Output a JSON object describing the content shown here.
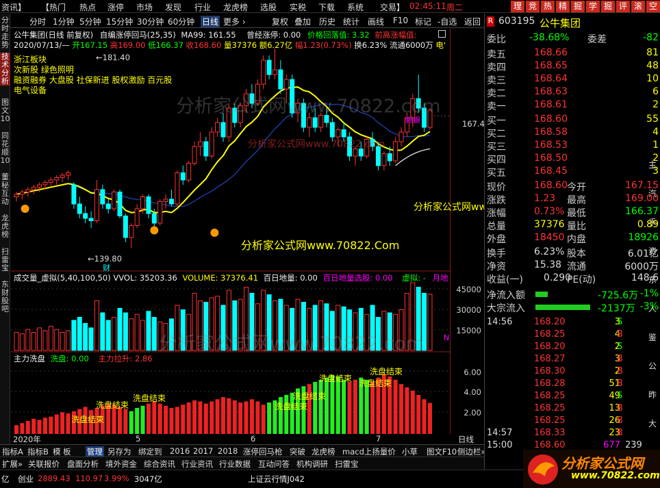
{
  "menubar": {
    "items": [
      "资讯】",
      "【热门",
      "热点",
      "涨停",
      "市场",
      "发现",
      "行业",
      "龙虎榜",
      "选股",
      "实税",
      "下载",
      "系统",
      "交易】"
    ],
    "clock": "02:45:11",
    "weekday": "周二",
    "badges": [
      "理",
      "竞",
      "热",
      "精",
      "掘",
      "学",
      "掘",
      "评",
      "滚",
      "空"
    ]
  },
  "toolbar": {
    "items": [
      "分时",
      "1分钟",
      "5分钟",
      "15分钟",
      "30分钟",
      "60分钟",
      "日线",
      "更多 ›",
      "复权",
      "叠加",
      "历史",
      "统计",
      "画线",
      "F10",
      "标记",
      "-自选",
      "返回"
    ],
    "active": "日线"
  },
  "leftnav": [
    "分时走势",
    "技术分析",
    "图文10",
    "同花顺10",
    "董秘互动",
    "龙虎榜",
    "扫雷宝",
    "东财股吧"
  ],
  "chart": {
    "title": "公牛集团(日线 前复权)",
    "indicator": "自编涨停回马(25,35)",
    "ma": "MA99: 161.55",
    "surge": "曾经涨停: 0.00",
    "pullback": "价格回落值: 3.32",
    "prevhigh": "前高涨幅值:",
    "date": "2020/07/13/—",
    "open": "开167.15",
    "high": "高169.00",
    "low": "低166.37",
    "close": "收168.60",
    "volume": "量37376",
    "amount": "额6.27亿",
    "chg": "幅1.23(0.73%)",
    "turnover": "换6.23%",
    "float": "流通6000万",
    "tail": "电'",
    "concepts": [
      "浙江板块",
      "次新股 绿色照明",
      "融资融券 大盘股 社保新进 股权激励 百元股",
      "电气设备"
    ],
    "hi_label": "181.40",
    "lo_label": "139.80",
    "cai": "财",
    "price_level": "167.4",
    "hammer": "蜥蜴",
    "vol_title": "成交量_虚拟(5,40,100,50)",
    "vol_wvol": "VVOL: 35203.36",
    "vol_volume": "VOLUME: 37376.41",
    "vol_bdl": "百日地量: 0.00",
    "vol_bdlxg": "百日地量选股: 0.00",
    "vol_xn": "虚拟: -",
    "vol_yd": "月地",
    "vol_axis": [
      "45000",
      "30000",
      "15000"
    ],
    "vol_n": "N",
    "zl_title": "主力洗盘",
    "zl_xp": "洗盘: 0.00",
    "zl_lx": "主力拉升: 2.86",
    "zl_axis": [
      "6.00",
      "4.00",
      "2.00"
    ],
    "zl_labels": [
      "洗盘结束",
      "洗盘结束",
      "洗盘结束",
      "洗盘结束",
      "洗盘结束",
      "洗盘结束",
      "洗盘结束",
      "洗盘结束",
      "洗盘结束"
    ],
    "x_labels": [
      "2020年",
      "5",
      "6",
      "7",
      "日线"
    ]
  },
  "chart_data": {
    "type": "candlestick",
    "candles": [
      [
        150.5,
        151.5,
        149.5,
        151
      ],
      [
        151,
        152,
        150,
        151.5
      ],
      [
        151.5,
        152.5,
        150.5,
        152
      ],
      [
        152,
        153,
        151,
        152.5
      ],
      [
        152.5,
        153.5,
        151.5,
        153
      ],
      [
        153,
        154,
        152,
        153.5
      ],
      [
        153.5,
        154.5,
        152.5,
        154
      ],
      [
        154,
        155,
        153,
        154.5
      ],
      [
        154.5,
        155.5,
        153.5,
        155
      ],
      [
        155,
        156,
        154,
        155.5
      ],
      [
        153,
        153.5,
        148,
        149
      ],
      [
        149,
        150.5,
        146,
        147
      ],
      [
        147,
        148.5,
        145,
        146
      ],
      [
        146,
        147.5,
        144,
        145.5
      ],
      [
        145.5,
        154,
        145,
        152
      ],
      [
        152,
        153,
        148,
        149
      ],
      [
        149,
        150,
        147,
        148
      ],
      [
        148,
        152,
        147.5,
        151.5
      ],
      [
        151.5,
        152,
        146,
        146.5
      ],
      [
        146.5,
        147,
        141,
        142
      ],
      [
        142,
        145,
        139.8,
        144.5
      ],
      [
        144.5,
        149,
        144,
        148
      ],
      [
        148,
        151,
        147,
        150.5
      ],
      [
        150.5,
        151,
        146,
        147
      ],
      [
        147,
        148,
        144,
        145
      ],
      [
        145,
        150,
        144.5,
        149.5
      ],
      [
        149.5,
        151,
        148,
        150
      ],
      [
        150,
        152,
        148.5,
        149
      ],
      [
        149,
        156,
        148.5,
        155.5
      ],
      [
        155.5,
        157,
        153,
        154
      ],
      [
        154,
        158,
        153.5,
        157.5
      ],
      [
        157.5,
        162,
        157,
        161
      ],
      [
        161,
        164,
        159,
        162
      ],
      [
        162,
        163,
        158,
        159
      ],
      [
        159,
        165,
        158.5,
        164
      ],
      [
        164,
        167,
        163,
        166
      ],
      [
        166,
        168,
        162,
        163
      ],
      [
        163,
        170,
        162,
        169
      ],
      [
        169,
        170,
        165,
        166
      ],
      [
        166,
        170,
        165,
        169.5
      ],
      [
        169.5,
        173,
        168,
        172
      ],
      [
        172,
        174,
        169,
        170
      ],
      [
        170,
        175,
        169.5,
        174
      ],
      [
        174,
        180,
        173,
        179
      ],
      [
        179,
        180,
        175,
        176
      ],
      [
        176,
        181.4,
        175,
        177
      ],
      [
        177,
        179,
        172,
        173
      ],
      [
        173,
        176,
        170,
        175
      ],
      [
        175,
        176,
        167,
        168
      ],
      [
        168,
        171,
        166,
        170
      ],
      [
        170,
        171,
        164,
        165
      ],
      [
        165,
        168,
        163,
        167
      ],
      [
        167,
        169,
        164,
        165
      ],
      [
        165,
        168,
        164,
        167.5
      ],
      [
        167.5,
        169,
        165,
        166
      ],
      [
        166,
        167,
        162,
        163
      ],
      [
        163,
        165,
        161,
        164.5
      ],
      [
        164.5,
        166,
        162,
        163
      ],
      [
        163,
        164,
        158,
        159
      ],
      [
        159,
        161,
        157,
        160.5
      ],
      [
        160.5,
        162,
        158,
        159
      ],
      [
        159,
        163,
        158.5,
        162.5
      ],
      [
        162.5,
        164,
        160,
        161
      ],
      [
        161,
        162,
        156,
        157
      ],
      [
        157,
        160,
        156,
        159.5
      ],
      [
        159.5,
        161,
        157,
        158
      ],
      [
        158,
        163,
        157.5,
        162
      ],
      [
        162,
        165,
        161,
        164
      ],
      [
        164,
        168,
        163,
        167
      ],
      [
        167,
        172,
        165,
        171
      ],
      [
        171,
        176,
        168,
        169
      ],
      [
        169,
        170,
        164,
        165
      ],
      [
        165,
        169,
        164.5,
        168.6
      ]
    ],
    "volume": [
      12000,
      11000,
      14000,
      12000,
      15000,
      13000,
      16000,
      14000,
      12000,
      13000,
      20000,
      22000,
      18000,
      15000,
      33000,
      25000,
      20000,
      22000,
      28000,
      25000,
      21000,
      24000,
      20000,
      26000,
      22000,
      19000,
      18000,
      21000,
      30000,
      27000,
      24000,
      38000,
      33000,
      32000,
      35000,
      36000,
      30000,
      40000,
      33000,
      34000,
      42000,
      38000,
      31000,
      40000,
      37000,
      33000,
      34000,
      30000,
      28000,
      34000,
      32000,
      28000,
      30000,
      33000,
      31000,
      26000,
      30000,
      29000,
      27000,
      25000,
      28000,
      24000,
      30000,
      22000,
      26000,
      25000,
      24000,
      27000,
      38000,
      45000,
      42000,
      38000,
      37376
    ],
    "ma99": 161.55,
    "zhuli": [
      0.8,
      1.0,
      1.2,
      1.4,
      1.3,
      1.5,
      1.6,
      1.8,
      2.0,
      1.9,
      2.1,
      2.3,
      2.5,
      2.2,
      2.4,
      2.6,
      2.8,
      2.7,
      2.5,
      2.3,
      2.1,
      2.4,
      2.6,
      2.8,
      3.0,
      2.8,
      2.6,
      2.4,
      2.5,
      2.7,
      2.9,
      3.1,
      3.0,
      2.8,
      3.0,
      3.2,
      3.4,
      3.3,
      3.1,
      2.9,
      3.0,
      3.2,
      3.0,
      2.7,
      2.9,
      3.1,
      3.4,
      3.6,
      3.8,
      4.2,
      4.4,
      4.6,
      4.8,
      5.0,
      5.2,
      5.4,
      5.3,
      5.0,
      4.8,
      5.0,
      5.2,
      5.0,
      4.8,
      5.2,
      5.5,
      5.3,
      5.0,
      4.6,
      4.3,
      4.0,
      3.6,
      3.2,
      2.86
    ]
  },
  "right": {
    "code": "603195",
    "name": "公牛集团",
    "weibi_label": "委比",
    "weibi": "-38.68%",
    "weicha_label": "委差",
    "weicha": "-82",
    "asks": [
      [
        "卖五",
        "168.66",
        "81"
      ],
      [
        "卖四",
        "168.65",
        "48"
      ],
      [
        "卖三",
        "168.64",
        "10"
      ],
      [
        "卖二",
        "168.63",
        "6"
      ],
      [
        "卖一",
        "168.61",
        "2"
      ]
    ],
    "bids": [
      [
        "买一",
        "168.60",
        "55"
      ],
      [
        "买二",
        "168.58",
        "4"
      ],
      [
        "买三",
        "168.53",
        "1"
      ],
      [
        "买四",
        "168.50",
        "2"
      ],
      [
        "买五",
        "168.45",
        "3"
      ]
    ],
    "stats": [
      [
        "现价",
        "168.60",
        "今开",
        "167.15"
      ],
      [
        "涨跌",
        "1.23",
        "最高",
        "169.00"
      ],
      [
        "涨幅",
        "0.73%",
        "最低",
        "166.37"
      ],
      [
        "总量",
        "37376",
        "量比",
        "0.89"
      ],
      [
        "外盘",
        "18450",
        "内盘",
        "18926"
      ]
    ],
    "stats2": [
      [
        "换手",
        "6.23%",
        "股本",
        "6.01亿"
      ],
      [
        "净资",
        "15.38",
        "流通",
        "6000万"
      ],
      [
        "收益(一)",
        "0.290",
        "PE(动)",
        "148.6"
      ]
    ],
    "flows": [
      [
        "净流入额",
        "-725.6万",
        "-1%"
      ],
      [
        "大宗流入",
        "-2137万",
        "-3%"
      ]
    ],
    "ticks": [
      [
        "14:56",
        "168.20",
        "3",
        "S"
      ],
      [
        "",
        "168.25",
        "4",
        "B"
      ],
      [
        "",
        "168.20",
        "2",
        "S"
      ],
      [
        "",
        "168.27",
        "3",
        "B"
      ],
      [
        "",
        "168.30",
        "2",
        "B"
      ],
      [
        "",
        "168.28",
        "51",
        "B"
      ],
      [
        "",
        "168.25",
        "49",
        "S"
      ],
      [
        "",
        "168.25",
        "13",
        "B"
      ],
      [
        "",
        "168.25",
        "26",
        "B"
      ],
      [
        "14:57",
        "168.33",
        "23",
        "B"
      ],
      [
        "15:00",
        "168.60",
        "677",
        "239"
      ]
    ],
    "side_chars": [
      "主",
      "汽",
      "手",
      "资",
      "东",
      "人",
      "鉴",
      "公",
      "昨",
      "大"
    ]
  },
  "tabbar": [
    "指标A",
    "指标B",
    "模 板",
    "管理",
    "另存为",
    "绑定到",
    "2016",
    "2017",
    "2018",
    "涨停回马枪",
    "突破",
    "龙虎榜",
    "macd上扬量价",
    "小草"
  ],
  "tabbar_active": "管理",
  "tabbar_right": "图文F10",
  "tabbar_right2": "侧边栏»",
  "tabbar2": [
    "扩展»",
    "关联报价",
    "盘面分析",
    "境外资金",
    "综合资讯",
    "行业资讯",
    "行业数据",
    "互动问答",
    "机构调研",
    "扫雷宝"
  ],
  "tabbar2_right": "笔",
  "status": {
    "cy_label": "亿",
    "cyb": "创业",
    "cyb_val": "2889.43",
    "cyb_chg": "110.97",
    "cyb_pct": "3.99%",
    "cyb_amt": "3047亿",
    "ticker": "上证云行情J042"
  },
  "watermark": {
    "main": "分析家公式网www.70822.com",
    "site1": "分析家公式网www.70822.Com",
    "site2": "分析家公式网www.70822.Com",
    "red": "分析家公式网www.70822.com"
  },
  "logo": {
    "text": "分析家公式网",
    "url": "www.70822.com"
  }
}
